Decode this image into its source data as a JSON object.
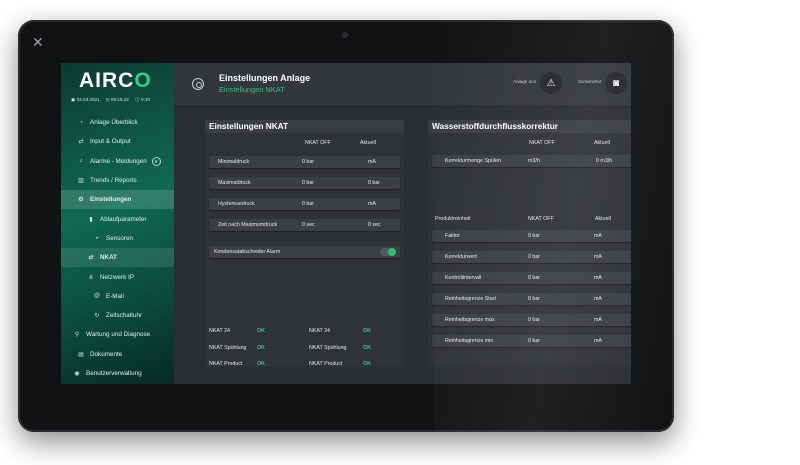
{
  "tablet": {
    "close_glyph": "✕"
  },
  "app": {
    "logo_prefix": "AIRC",
    "logo_accent": "O"
  },
  "sysbar": {
    "date": "03.03.2021",
    "time": "09:15:22",
    "version": "V:10"
  },
  "sidebar": {
    "items": [
      {
        "label": "Anlage Überblick",
        "icon": "dashboard-icon",
        "glyph": "◔"
      },
      {
        "label": "Input & Output",
        "icon": "swap-icon",
        "glyph": "⇄"
      },
      {
        "label": "Alarme - Meldungen",
        "icon": "bell-icon",
        "glyph": "♪",
        "badge": "5"
      },
      {
        "label": "Trends / Reports",
        "icon": "chart-icon",
        "glyph": "▥"
      },
      {
        "label": "Einstellungen",
        "icon": "gear-icon",
        "glyph": "⚙"
      },
      {
        "label": "Ablaufparameter",
        "icon": "document-icon",
        "glyph": "▮"
      },
      {
        "label": "Sensoren",
        "icon": "gauge-icon",
        "glyph": "◒"
      },
      {
        "label": "NKAT",
        "icon": "swap-icon",
        "glyph": "⇄"
      },
      {
        "label": "Netzwerk IP",
        "icon": "network-icon",
        "glyph": "⋔"
      },
      {
        "label": "E-Mail",
        "icon": "at-icon",
        "glyph": "@"
      },
      {
        "label": "Zeitschaltuhr",
        "icon": "clock-icon",
        "glyph": "↻"
      },
      {
        "label": "Wartung und Diagnose",
        "icon": "wrench-icon",
        "glyph": "⚲"
      },
      {
        "label": "Dokumente",
        "icon": "file-icon",
        "glyph": "▤"
      },
      {
        "label": "Benutzerverwaltung",
        "icon": "user-icon",
        "glyph": "◉"
      }
    ]
  },
  "header": {
    "title": "Einstellungen Anlage",
    "subtitle": "Einstellungen NKAT",
    "action1_label": "Anlage aus",
    "action2_label": "Screenshot",
    "warning_glyph": "⚠",
    "camera_glyph": "◙"
  },
  "nkat": {
    "title": "Einstellungen NKAT",
    "col1": "NKAT OFF",
    "col2": "Aktuell",
    "rows": [
      {
        "label": "Minimaldruck",
        "off": "0 bar",
        "cur": "mA"
      },
      {
        "label": "Maximaldruck",
        "off": "0 bar",
        "cur": "0 bar"
      },
      {
        "label": "Hysteresedruck",
        "off": "0 bar",
        "cur": "mA"
      },
      {
        "label": "Zeit nach Maximumdruck",
        "off": "0 sec",
        "cur": "0 sec"
      }
    ],
    "toggle_label": "Kondensatabscheider Alarm",
    "toggle_on": true,
    "status": [
      {
        "l1": "NKAT 24",
        "v1": "OK",
        "l2": "NKAT 24",
        "v2": "OK"
      },
      {
        "l1": "NKAT Spühlung",
        "v1": "OK",
        "l2": "NKAT Spühlung",
        "v2": "OK"
      },
      {
        "l1": "NKAT Product",
        "v1": "OK",
        "l2": "NKAT Product",
        "v2": "OK"
      }
    ]
  },
  "wsd": {
    "title": "Wasserstoffdurchflusskorrektur",
    "col1": "NKAT OFF",
    "col2": "Aktuell",
    "row": {
      "label": "Korrekturmenge Spülen",
      "off": "m3/h",
      "cur": "0 m3/h"
    },
    "group_label": "Produktreinheit",
    "group_col1": "NKAT OFF",
    "group_col2": "Aktuell",
    "rows": [
      {
        "label": "Faktor",
        "off": "0 bar",
        "cur": "mA"
      },
      {
        "label": "Korrekturwert",
        "off": "0 bar",
        "cur": "mA"
      },
      {
        "label": "Kontrollintervall",
        "off": "0 bar",
        "cur": "mA"
      },
      {
        "label": "Reinheitsgrenze Start",
        "off": "0 bar",
        "cur": "mA"
      },
      {
        "label": "Reinheitsgrenze max",
        "off": "0 bar",
        "cur": "mA"
      },
      {
        "label": "Reinheitsgrenze min",
        "off": "0 bar",
        "cur": "mA"
      }
    ]
  },
  "colors": {
    "accent": "#2fd08a",
    "sidebar_top": "#0c3a2e",
    "panel": "#2f3237"
  }
}
